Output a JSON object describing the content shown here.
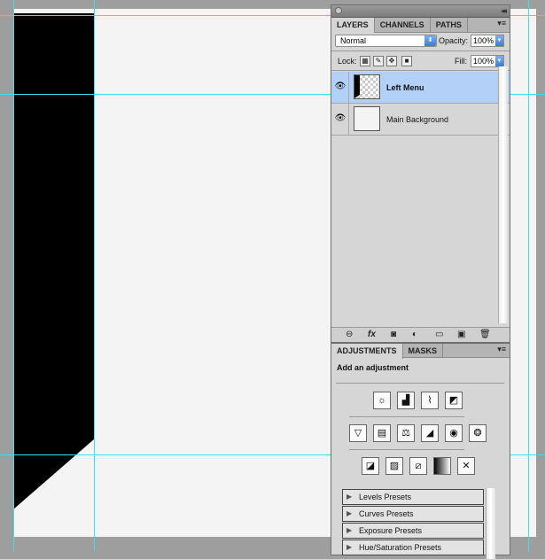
{
  "colors": {
    "canvas_gray": "#9e9e9e",
    "document_bg": "#f4f4f4",
    "guide": "#3ddfe8",
    "selection": "#b3d0f8"
  },
  "layers_panel": {
    "tabs": [
      "LAYERS",
      "CHANNELS",
      "PATHS"
    ],
    "blend_mode": "Normal",
    "opacity_label": "Opacity:",
    "opacity_value": "100%",
    "lock_label": "Lock:",
    "fill_label": "Fill:",
    "fill_value": "100%",
    "layers": [
      {
        "name": "Left Menu",
        "selected": true,
        "visible": true
      },
      {
        "name": "Main Background",
        "selected": false,
        "visible": true
      }
    ],
    "footer_icons": [
      "link-icon",
      "fx-icon",
      "mask-icon",
      "adjustment-icon",
      "group-icon",
      "new-layer-icon",
      "trash-icon"
    ]
  },
  "adjustments_panel": {
    "tabs": [
      "ADJUSTMENTS",
      "MASKS"
    ],
    "heading": "Add an adjustment",
    "row1": [
      "brightness-icon",
      "levels-icon",
      "curves-icon",
      "exposure-icon"
    ],
    "row2": [
      "vibrance-icon",
      "hue-saturation-icon",
      "color-balance-icon",
      "black-white-icon",
      "photo-filter-icon",
      "channel-mixer-icon"
    ],
    "row3": [
      "invert-icon",
      "posterize-icon",
      "threshold-icon",
      "gradient-map-icon",
      "selective-color-icon"
    ],
    "presets": [
      "Levels Presets",
      "Curves Presets",
      "Exposure Presets",
      "Hue/Saturation Presets"
    ]
  }
}
